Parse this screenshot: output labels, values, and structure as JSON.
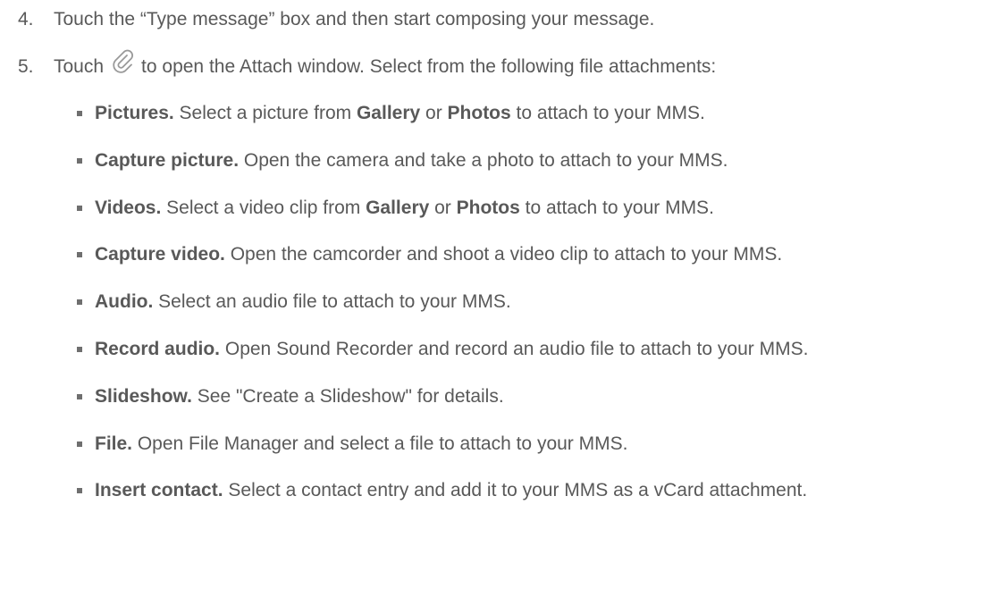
{
  "step_4": {
    "number": "4.",
    "text": "Touch the “Type message” box and then start composing your message."
  },
  "step_5": {
    "number": "5.",
    "text_before_icon": "Touch",
    "icon": "paperclip-icon",
    "text_after_icon": "to open the Attach window. Select from the following file attachments:"
  },
  "attachments": [
    {
      "term": "Pictures.",
      "parts": [
        {
          "text": " Select a picture from "
        },
        {
          "text": "Gallery",
          "bold": true
        },
        {
          "text": " or "
        },
        {
          "text": "Photos",
          "bold": true
        },
        {
          "text": " to attach to your MMS."
        }
      ]
    },
    {
      "term": "Capture picture.",
      "parts": [
        {
          "text": " Open the camera and take a photo to attach to your MMS."
        }
      ]
    },
    {
      "term": "Videos.",
      "parts": [
        {
          "text": " Select a video clip from "
        },
        {
          "text": "Gallery",
          "bold": true
        },
        {
          "text": " or "
        },
        {
          "text": "Photos",
          "bold": true
        },
        {
          "text": " to attach to your MMS."
        }
      ]
    },
    {
      "term": "Capture video.",
      "parts": [
        {
          "text": " Open the camcorder and shoot a video clip to attach to your MMS."
        }
      ]
    },
    {
      "term": "Audio.",
      "parts": [
        {
          "text": " Select an audio file to attach to your MMS."
        }
      ]
    },
    {
      "term": "Record audio.",
      "parts": [
        {
          "text": " Open Sound Recorder and record an audio file to attach to your MMS."
        }
      ]
    },
    {
      "term": "Slideshow.",
      "parts": [
        {
          "text": " See \"Create a Slideshow\" for details."
        }
      ]
    },
    {
      "term": "File.",
      "parts": [
        {
          "text": " Open File Manager and select a file to attach to your MMS."
        }
      ]
    },
    {
      "term": "Insert contact.",
      "parts": [
        {
          "text": " Select a contact entry and add it to your MMS as a vCard attachment."
        }
      ]
    }
  ],
  "colors": {
    "text": "#595959",
    "bullet": "#6f6f6f",
    "icon": "#9a9a9a"
  }
}
